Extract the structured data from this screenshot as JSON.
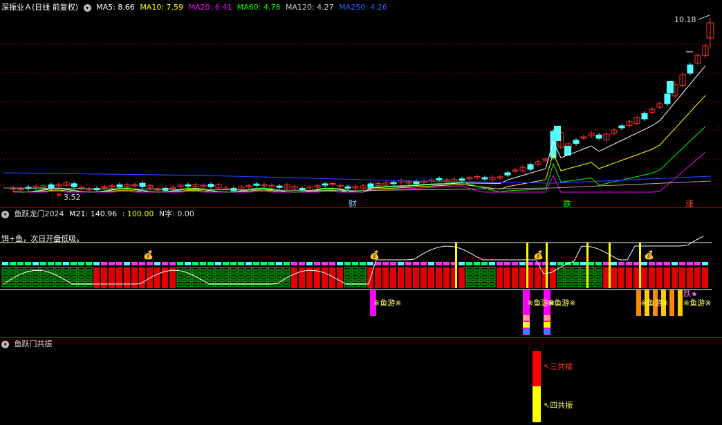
{
  "main": {
    "title": "深振业Ａ(日线 前复权)",
    "ma": [
      {
        "label": "MA5: 8.66",
        "color": "#ffffff"
      },
      {
        "label": "MA10: 7.59",
        "color": "#ffff00"
      },
      {
        "label": "MA20: 6.41",
        "color": "#ff00ff"
      },
      {
        "label": "MA60: 4.78",
        "color": "#00ff00"
      },
      {
        "label": "MA120: 4.27",
        "color": "#cccccc"
      },
      {
        "label": "MA250: 4.26",
        "color": "#3060ff"
      }
    ],
    "high_label": "10.18",
    "low_label": "3.52",
    "markers": [
      {
        "text": "财",
        "color": "#7fd0ff"
      },
      {
        "text": "跌",
        "color": "#00ff00"
      },
      {
        "text": "涨",
        "color": "#ff4040"
      }
    ]
  },
  "ind1": {
    "title": "鱼跃龙门2024",
    "m21": "M21: 140.96",
    "v100": ": 100.00",
    "nzi": "N字: 0.00",
    "note": "饵+鱼，次日开盘低吸。",
    "fish_text": "※鱼游※",
    "fall_text": "跌★"
  },
  "ind2": {
    "title": "鱼跃门共振",
    "label3": "三共振",
    "label4": "四共振",
    "arrow": "↖"
  },
  "colors": {
    "up": "#ff3232",
    "down": "#54ffff",
    "grid": "#8a0000"
  }
}
